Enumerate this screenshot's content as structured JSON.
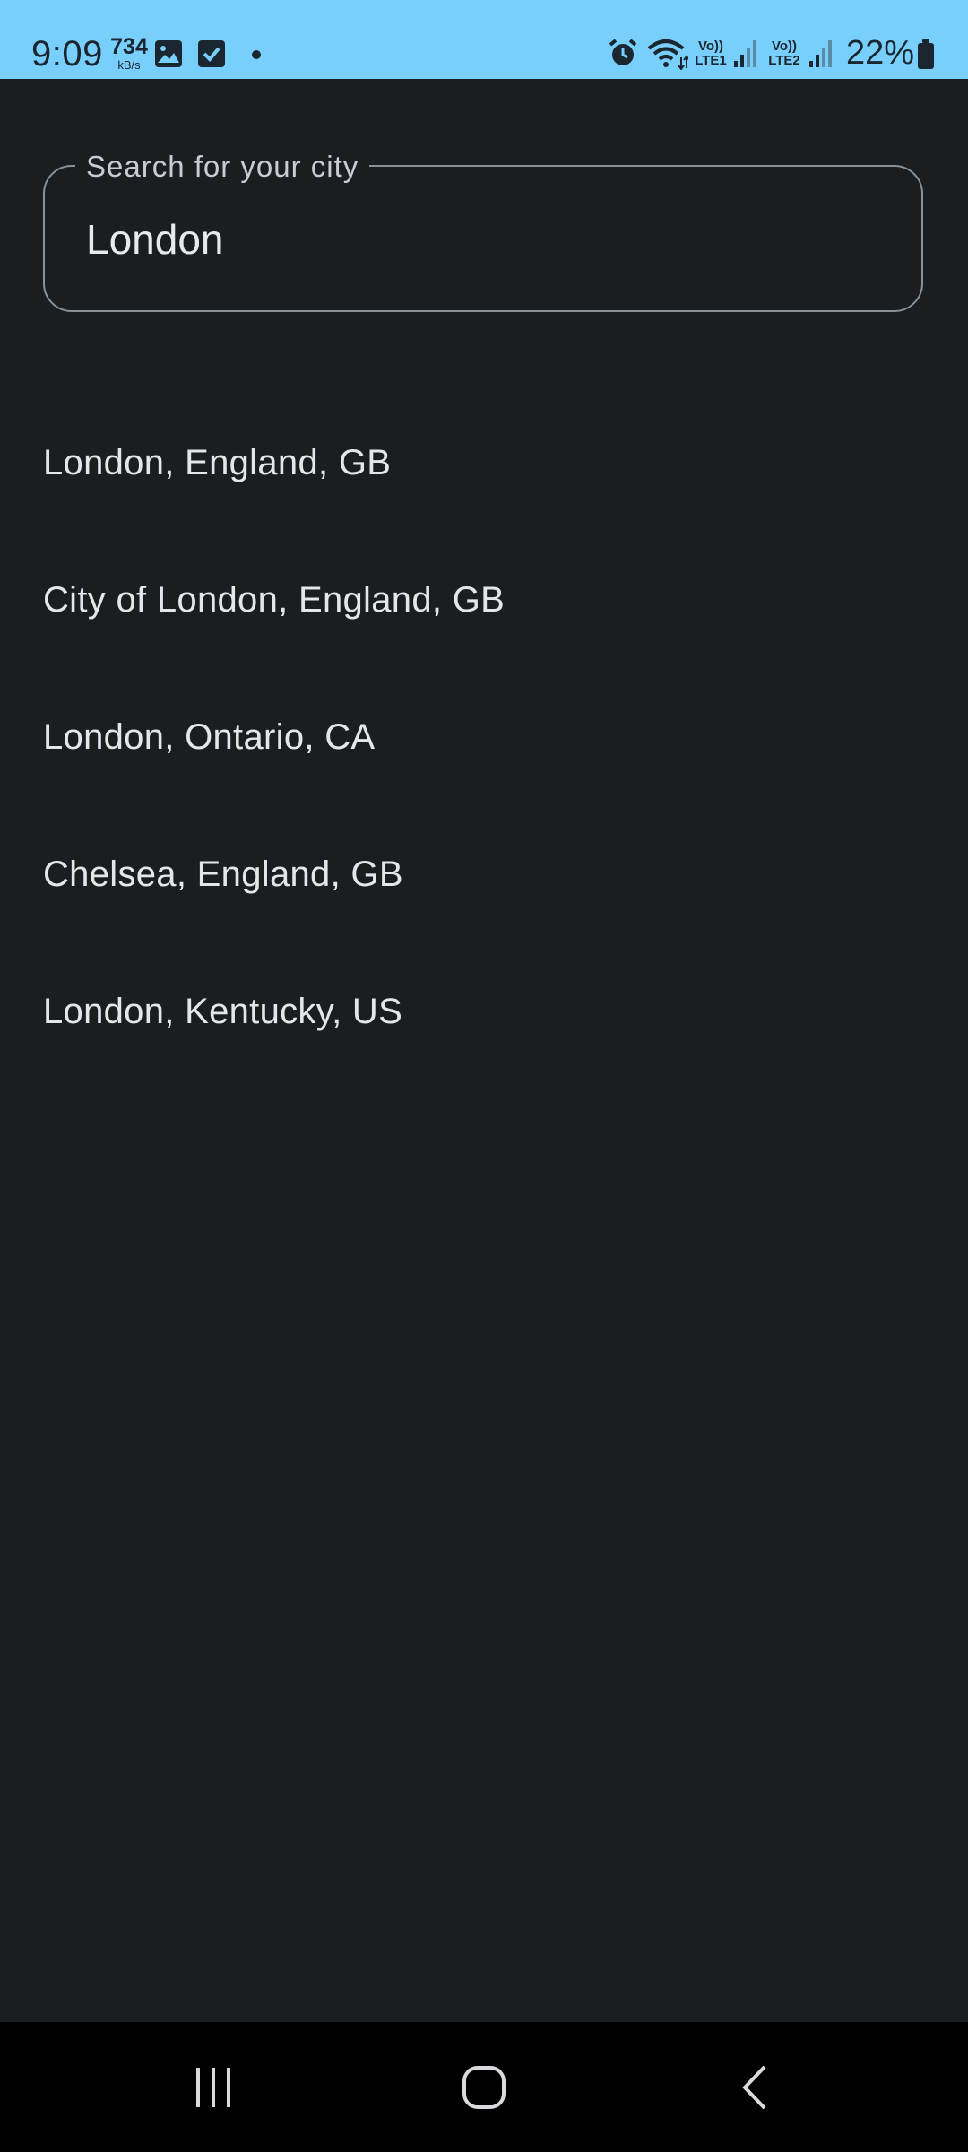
{
  "status_bar": {
    "time": "9:09",
    "speed_value": "734",
    "speed_unit": "kB/s",
    "battery_percent": "22%",
    "icons": [
      "image-icon",
      "check-square-icon",
      "dot-icon",
      "alarm-icon",
      "wifi-icon",
      "volte-lte1-icon",
      "signal-1-icon",
      "volte-lte2-icon",
      "signal-2-icon",
      "battery-icon"
    ],
    "sim1_label_top": "Vo))",
    "sim1_label_bottom": "LTE1",
    "sim2_label_top": "Vo))",
    "sim2_label_bottom": "LTE2"
  },
  "search": {
    "label": "Search for your city",
    "value": "London"
  },
  "results": [
    {
      "label": "London, England, GB"
    },
    {
      "label": "City of London, England, GB"
    },
    {
      "label": "London, Ontario, CA"
    },
    {
      "label": "Chelsea, England, GB"
    },
    {
      "label": "London, Kentucky, US"
    }
  ],
  "nav_bar": {
    "buttons": [
      "recent-apps-icon",
      "home-icon",
      "back-icon"
    ]
  },
  "colors": {
    "background": "#1b1e21",
    "status_bar": "#79cffb",
    "outline": "#8b9096",
    "text": "#e4e6ea"
  }
}
